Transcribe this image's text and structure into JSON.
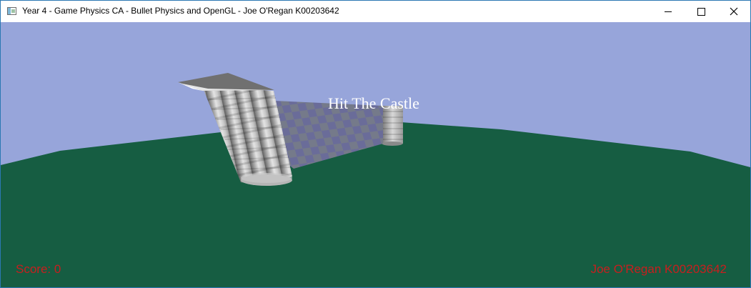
{
  "window": {
    "title": "Year 4 - Game Physics CA - Bullet Physics and OpenGL - Joe O'Regan K00203642",
    "icon": "opengl-window-icon",
    "buttons": {
      "minimize_icon": "minimize-icon",
      "maximize_icon": "maximize-icon",
      "close_icon": "close-icon"
    }
  },
  "hud": {
    "title": "Hit The Castle",
    "score_text": "Score: 0",
    "author_text": "Joe O'Regan K00203642"
  },
  "scene": {
    "sky_color": "#97a5da",
    "ground_color": "#165d42",
    "checker_light": "#757a8a",
    "checker_dark": "#6a6c99",
    "hud_text_color": "#c81e1e"
  }
}
